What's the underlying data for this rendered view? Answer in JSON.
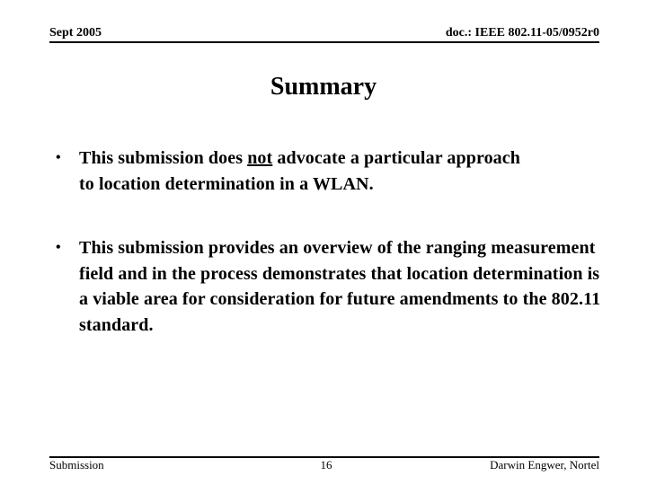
{
  "header": {
    "date": "Sept 2005",
    "doc_id": "doc.: IEEE 802.11-05/0952r0"
  },
  "slide": {
    "title": "Summary",
    "bullets": [
      {
        "before": "This submission does ",
        "emphasis": "not",
        "after": " advocate a particular approach to location determination in a WLAN."
      },
      {
        "text": "This submission provides an overview of the ranging measurement field and in the process demonstrates that location determination is a viable area for consideration for future amendments to the 802.11 standard."
      }
    ],
    "bullet_glyph": "•"
  },
  "footer": {
    "left": "Submission",
    "page_number": "16",
    "author": "Darwin Engwer, Nortel"
  }
}
